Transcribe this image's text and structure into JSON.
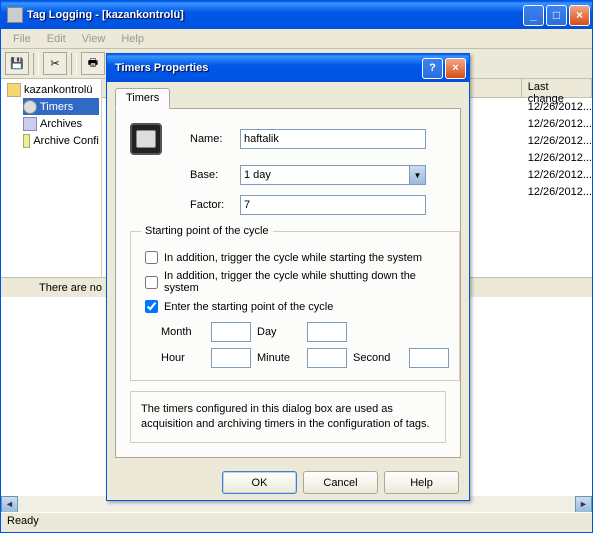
{
  "window": {
    "title": "Tag Logging - [kazankontrolü]",
    "minLabel": "_",
    "maxLabel": "□",
    "closeLabel": "×"
  },
  "menu": {
    "file": "File",
    "edit": "Edit",
    "view": "View",
    "help": "Help"
  },
  "tree": {
    "root": "kazankontrolü",
    "timers": "Timers",
    "archives": "Archives",
    "config": "Archive Confi"
  },
  "list": {
    "lastChangeHdr": "Last change",
    "rows": [
      {
        "date": "12/26/2012..."
      },
      {
        "date": "12/26/2012..."
      },
      {
        "date": "12/26/2012..."
      },
      {
        "date": "12/26/2012..."
      },
      {
        "date": "12/26/2012..."
      },
      {
        "date": "12/26/2012..."
      }
    ]
  },
  "bottom": {
    "msg": "There are no"
  },
  "status": {
    "text": "Ready"
  },
  "dialog": {
    "title": "Timers Properties",
    "help": "?",
    "close": "×",
    "tab": "Timers",
    "nameLabel": "Name:",
    "nameValue": "haftalik",
    "baseLabel": "Base:",
    "baseValue": "1 day",
    "factorLabel": "Factor:",
    "factorValue": "7",
    "group": {
      "legend": "Starting point of the cycle",
      "ck1": "In addition, trigger the cycle while starting the system",
      "ck2": "In addition, trigger the cycle while shutting down the system",
      "ck3": "Enter the starting point of the cycle",
      "month": "Month",
      "day": "Day",
      "hour": "Hour",
      "minute": "Minute",
      "second": "Second"
    },
    "note": "The timers configured in this dialog box are used as acquisition and archiving timers in the configuration of tags.",
    "ok": "OK",
    "cancel": "Cancel",
    "helpBtn": "Help"
  }
}
